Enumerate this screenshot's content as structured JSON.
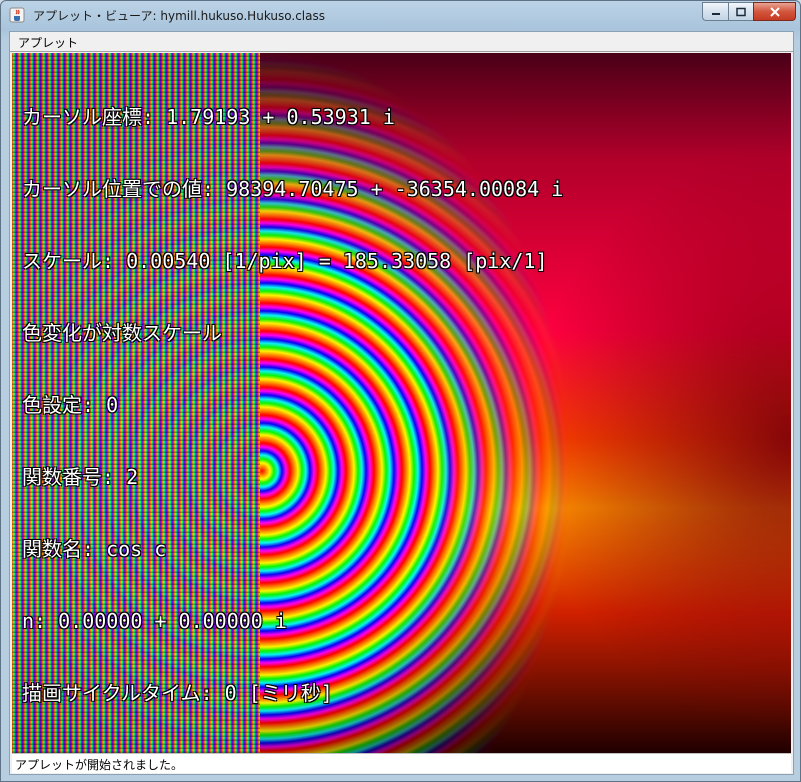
{
  "window": {
    "title": "アプレット・ビューア: hymill.hukuso.Hukuso.class"
  },
  "menu": {
    "items": [
      "アプレット"
    ]
  },
  "overlay": {
    "lines": [
      "カーソル座標: 1.79193 + 0.53931 i",
      "カーソル位置での値: 98394.70475 + -36354.00084 i",
      "スケール: 0.00540 [1/pix] = 185.33058 [pix/1]",
      "色変化が対数スケール",
      "色設定: 0",
      "関数番号: 2",
      "関数名: cos c",
      "n: 0.00000 + 0.00000 i",
      "描画サイクルタイム: 0 [ミリ秒]"
    ]
  },
  "status": {
    "text": "アプレットが開始されました。"
  },
  "icons": {
    "app": "java-cup-icon",
    "minimize": "minimize-icon",
    "maximize": "maximize-icon",
    "close": "close-icon"
  }
}
